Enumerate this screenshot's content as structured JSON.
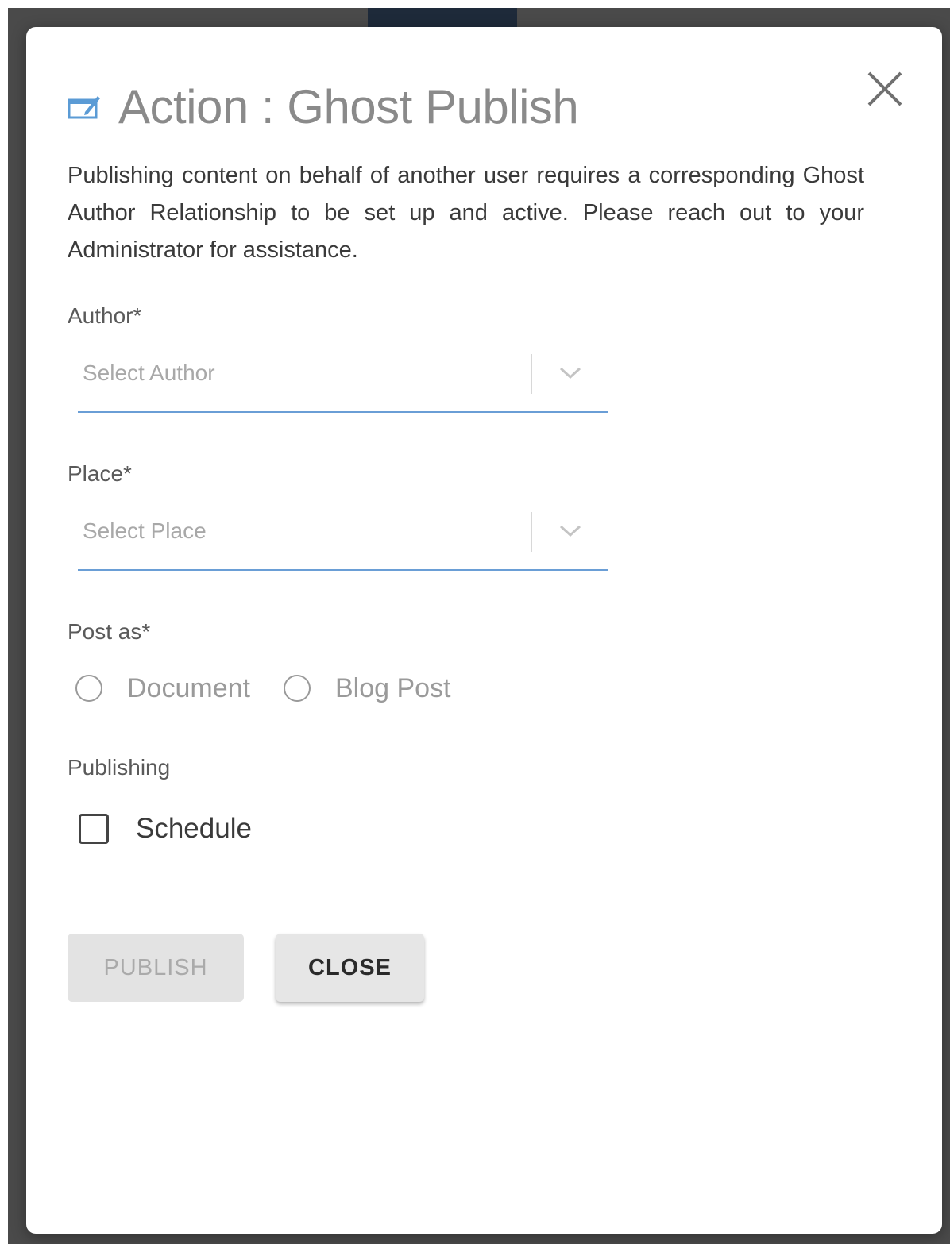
{
  "dialog": {
    "icon": "edit-window-icon",
    "title": "Action : Ghost Publish",
    "close_icon": "close-icon",
    "description": "Publishing content on behalf of another user requires a corresponding Ghost Author Relationship to be set up and active. Please reach out to your Administrator for assistance."
  },
  "form": {
    "author": {
      "label": "Author*",
      "placeholder": "Select Author"
    },
    "place": {
      "label": "Place*",
      "placeholder": "Select Place"
    },
    "post_as": {
      "label": "Post as*",
      "options": [
        "Document",
        "Blog Post"
      ]
    },
    "publishing": {
      "label": "Publishing",
      "schedule_label": "Schedule",
      "schedule_checked": false
    }
  },
  "buttons": {
    "publish": "PUBLISH",
    "close": "CLOSE"
  },
  "colors": {
    "accent_underline": "#6a9ed6",
    "icon_blue": "#5b9bd5",
    "title_gray": "#8a8a8a"
  }
}
